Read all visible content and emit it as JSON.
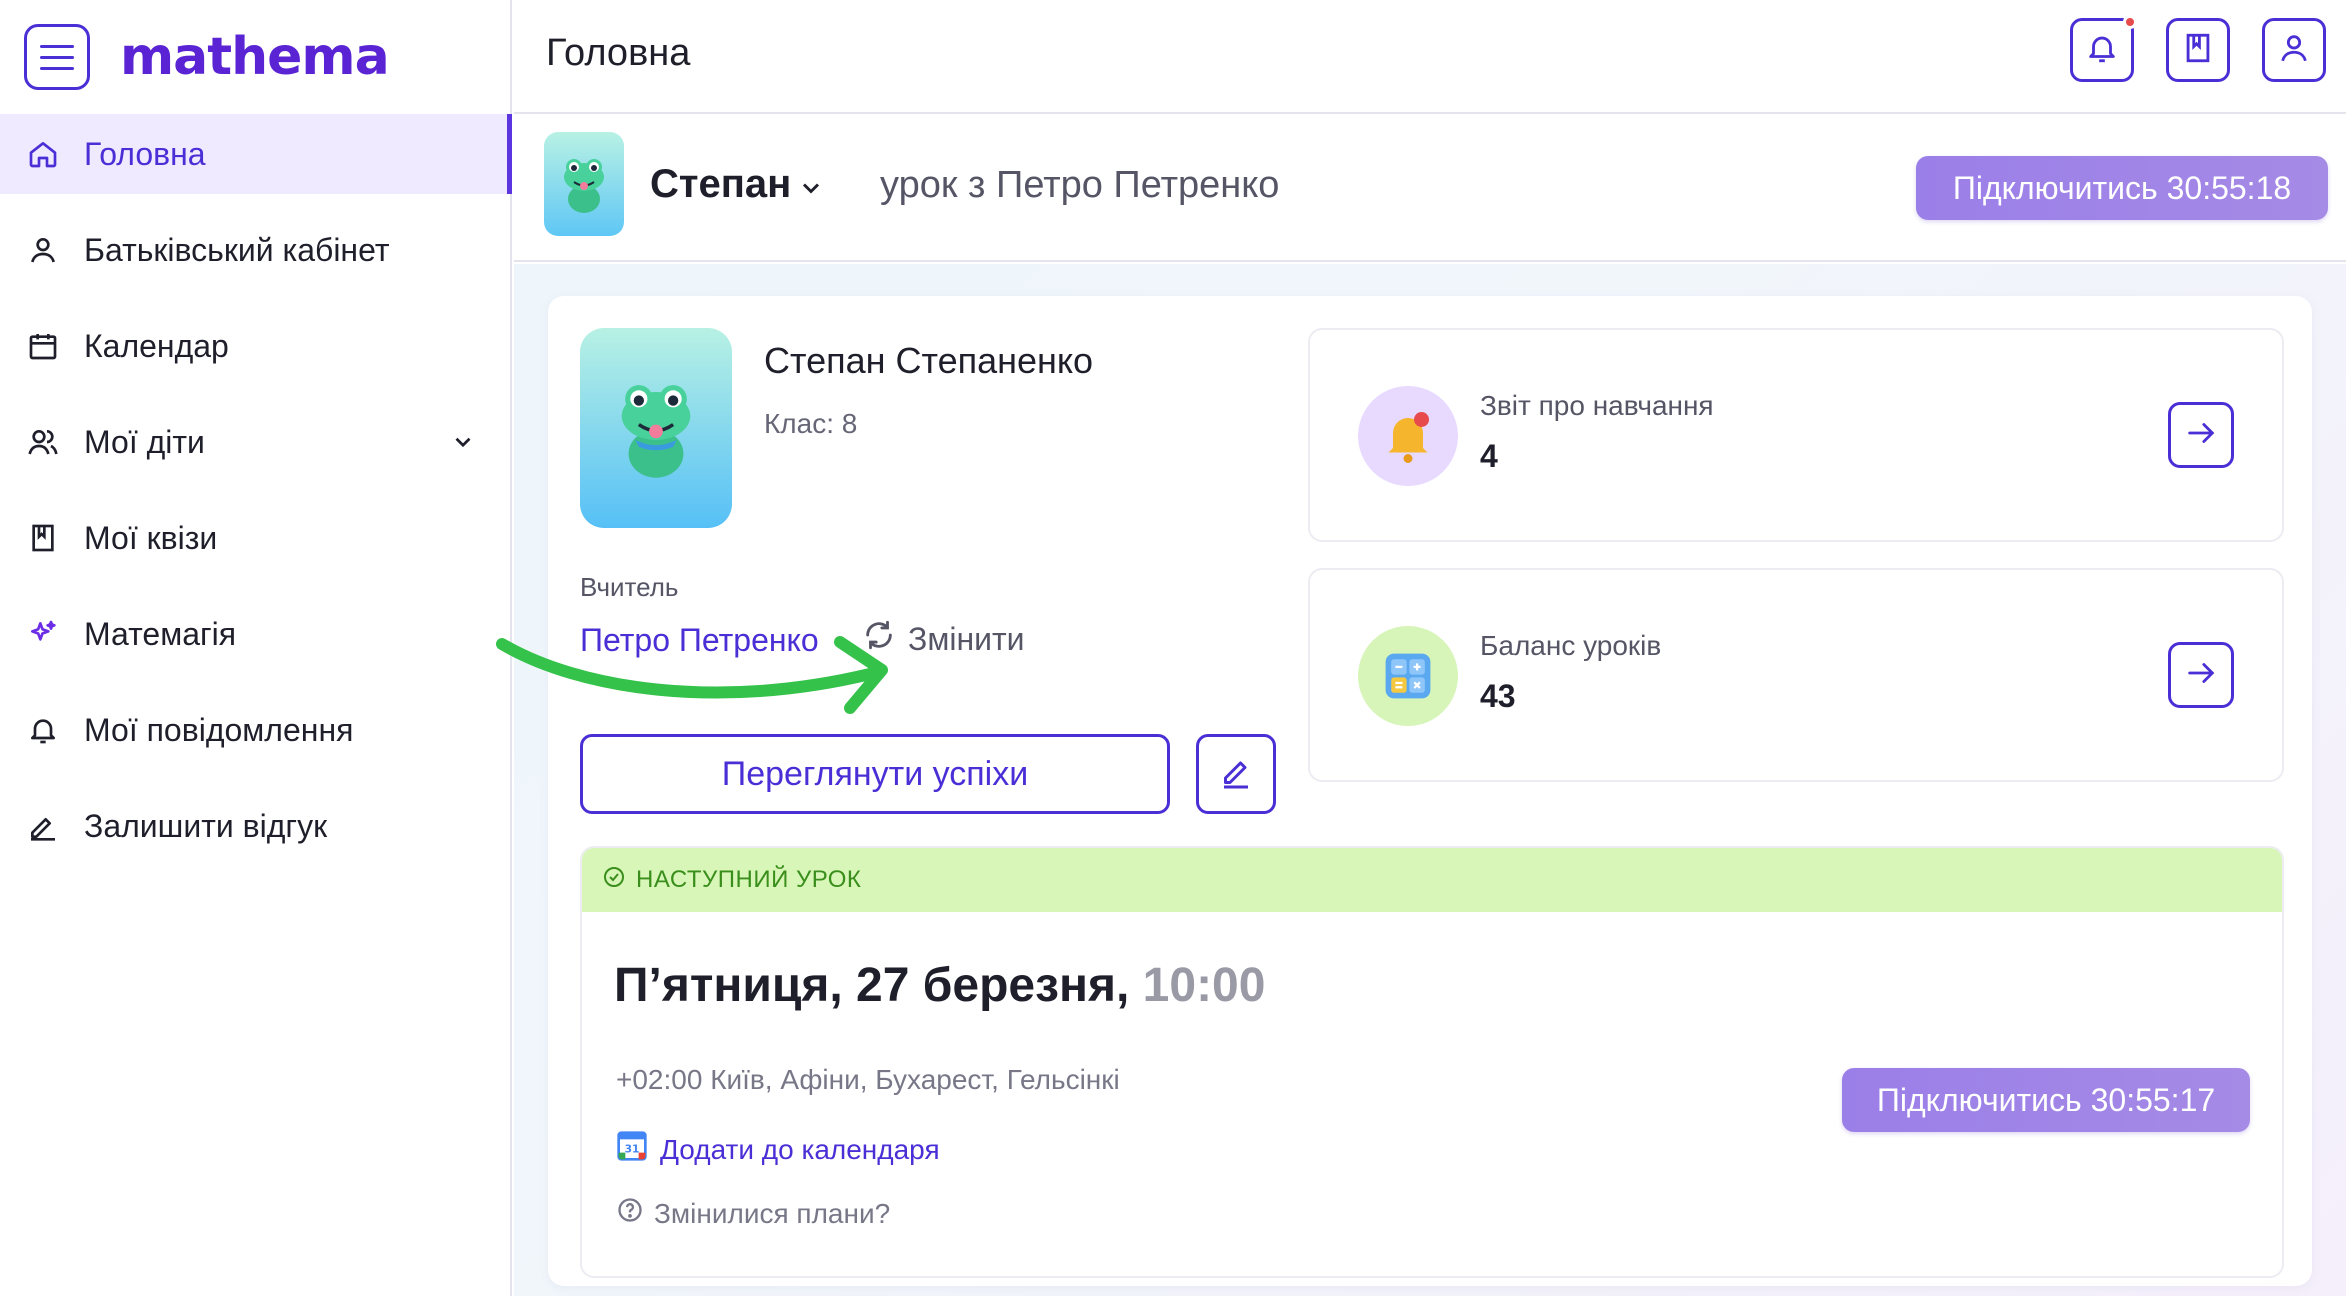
{
  "brand": {
    "logo_text": "mathema"
  },
  "sidebar": {
    "items": [
      {
        "label": "Головна",
        "icon": "home-icon",
        "active": true
      },
      {
        "label": "Батьківський кабінет",
        "icon": "user-icon"
      },
      {
        "label": "Календар",
        "icon": "calendar-icon"
      },
      {
        "label": "Мої діти",
        "icon": "children-icon",
        "expandable": true
      },
      {
        "label": "Мої квізи",
        "icon": "bookmark-icon"
      },
      {
        "label": "Матемагія",
        "icon": "sparkle-icon"
      },
      {
        "label": "Мої повідомлення",
        "icon": "bell-icon"
      },
      {
        "label": "Залишити відгук",
        "icon": "pencil-icon"
      }
    ]
  },
  "header": {
    "title": "Головна",
    "icons": [
      "bell-icon",
      "bookmark-icon",
      "profile-icon"
    ]
  },
  "subheader": {
    "child_name": "Степан",
    "lesson_text": "урок з Петро Петренко",
    "connect_label": "Підключитись 30:55:18"
  },
  "student": {
    "full_name": "Степан Степаненко",
    "class_text": "Клас: 8",
    "teacher_label": "Вчитель",
    "teacher_name": "Петро Петренко",
    "change_label": "Змінити",
    "view_progress_label": "Переглянути успіхи"
  },
  "stats": [
    {
      "label": "Звіт про навчання",
      "value": "4",
      "icon": "bell-emoji-icon"
    },
    {
      "label": "Баланс уроків",
      "value": "43",
      "icon": "calculator-emoji-icon"
    }
  ],
  "next_lesson": {
    "heading": "НАСТУПНИЙ УРОК",
    "date_text": "П’ятниця, 27 березня,",
    "time_text": "10:00",
    "timezone": "+02:00 Київ, Афіни, Бухарест, Гельсінкі",
    "add_calendar_label": "Додати до календаря",
    "calendar_badge": "31",
    "changed_plans_label": "Змінилися плани?",
    "connect_label": "Підключитись 30:55:17"
  },
  "colors": {
    "accent": "#4a2fd6",
    "connect_button": "#a58ae6",
    "next_lesson_banner": "#d9f6b9",
    "annotation_arrow": "#34c24a"
  }
}
